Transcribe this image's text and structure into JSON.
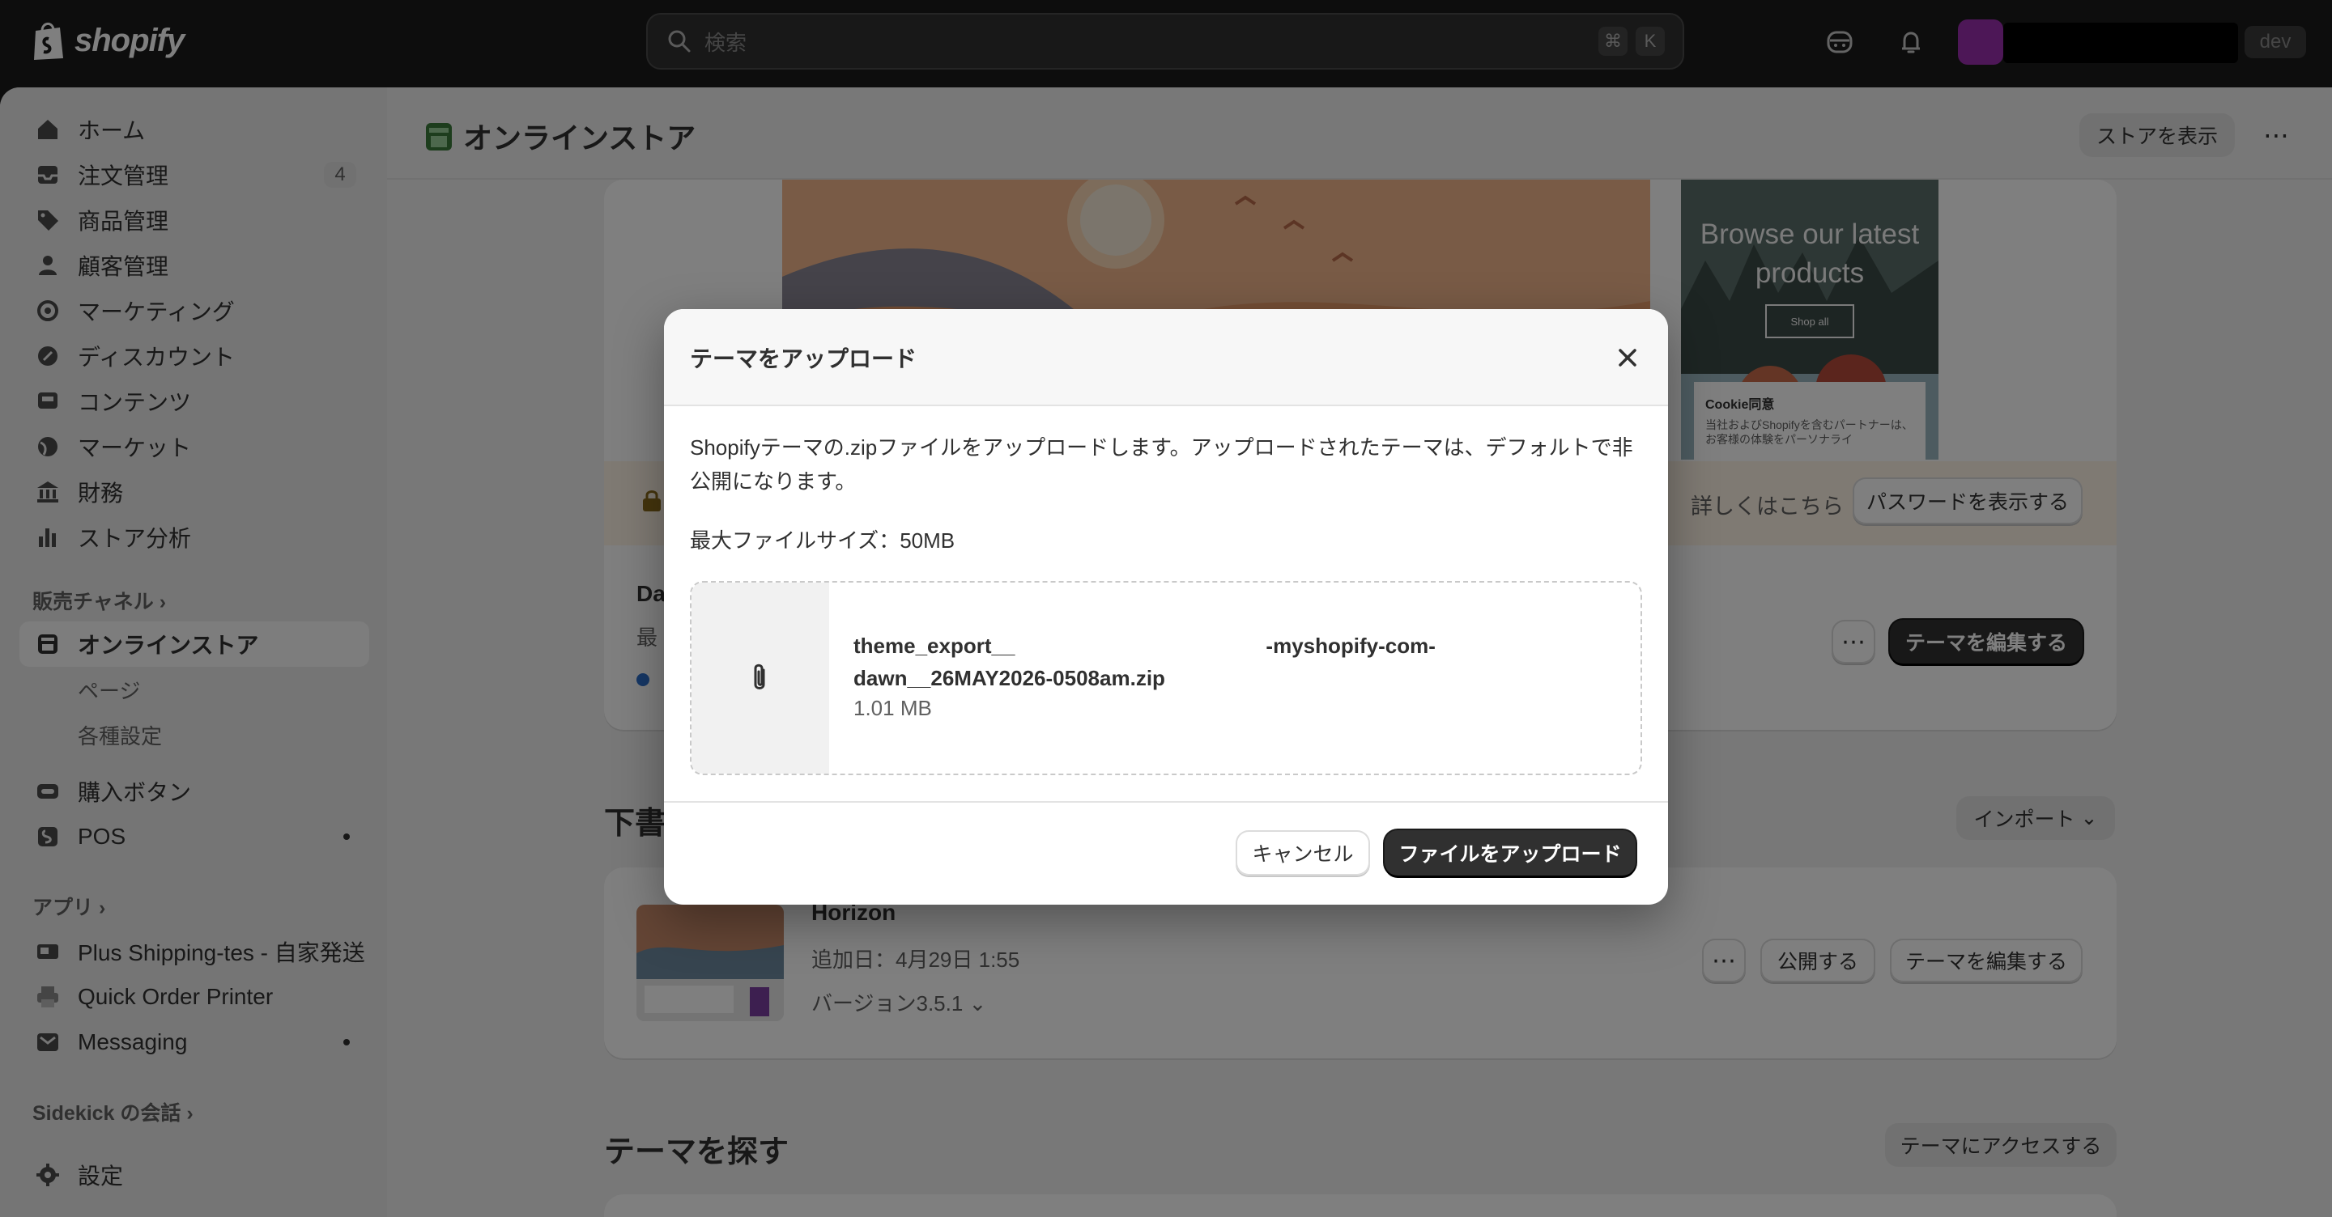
{
  "topbar": {
    "logo_text": "shopify",
    "search_placeholder": "検索",
    "shortcut_key1": "⌘",
    "shortcut_key2": "K",
    "store_label": "dev"
  },
  "sidebar": {
    "items": [
      {
        "label": "ホーム",
        "icon": "home-icon"
      },
      {
        "label": "注文管理",
        "icon": "inbox-icon",
        "badge": "4"
      },
      {
        "label": "商品管理",
        "icon": "tag-icon"
      },
      {
        "label": "顧客管理",
        "icon": "person-icon"
      },
      {
        "label": "マーケティング",
        "icon": "target-icon"
      },
      {
        "label": "ディスカウント",
        "icon": "discount-icon"
      },
      {
        "label": "コンテンツ",
        "icon": "content-icon"
      },
      {
        "label": "マーケット",
        "icon": "globe-icon"
      },
      {
        "label": "財務",
        "icon": "bank-icon"
      },
      {
        "label": "ストア分析",
        "icon": "chart-icon"
      }
    ],
    "sales_channels_label": "販売チャネル",
    "online_store_label": "オンラインストア",
    "sub_pages": "ページ",
    "sub_settings": "各種設定",
    "buy_button_label": "購入ボタン",
    "pos_label": "POS",
    "apps_label": "アプリ",
    "apps": [
      {
        "label": "Plus Shipping-tes - 自家発送"
      },
      {
        "label": "Quick Order Printer"
      },
      {
        "label": "Messaging"
      }
    ],
    "sidekick_label": "Sidekick の会話",
    "settings_label": "設定"
  },
  "page": {
    "title": "オンラインストア",
    "view_store_button": "ストアを表示",
    "more_label": "⋯",
    "mobile_preview_heading": "Browse our latest products",
    "mobile_preview_button": "Shop all",
    "cookie_title": "Cookie同意",
    "cookie_text": "当社およびShopifyを含むパートナーは、お客様の体験をパーソナライ",
    "learn_more": "詳しくはこちら",
    "show_password_button": "パスワードを表示する",
    "current_theme_initial": "Da",
    "current_theme_meta_initial": "最",
    "edit_theme_button": "テーマを編集する",
    "drafts_initial": "下書",
    "import_button": "インポート",
    "draft_theme": {
      "name": "Horizon",
      "added": "追加日：4月29日 1:55",
      "version": "バージョン3.5.1",
      "publish_button": "公開する",
      "edit_button": "テーマを編集する"
    },
    "explore_title": "テーマを探す",
    "access_themes_button": "テーマにアクセスする"
  },
  "modal": {
    "title": "テーマをアップロード",
    "description": "Shopifyテーマの.zipファイルをアップロードします。アップロードされたテーマは、デフォルトで非公開になります。",
    "max_size": "最大ファイルサイズ：50MB",
    "file_name_line1": "theme_export__",
    "file_name_line1_suffix": "-myshopify-com-",
    "file_name_line2": "dawn__26MAY2026-0508am.zip",
    "file_size": "1.01 MB",
    "cancel_button": "キャンセル",
    "upload_button": "ファイルをアップロード"
  }
}
